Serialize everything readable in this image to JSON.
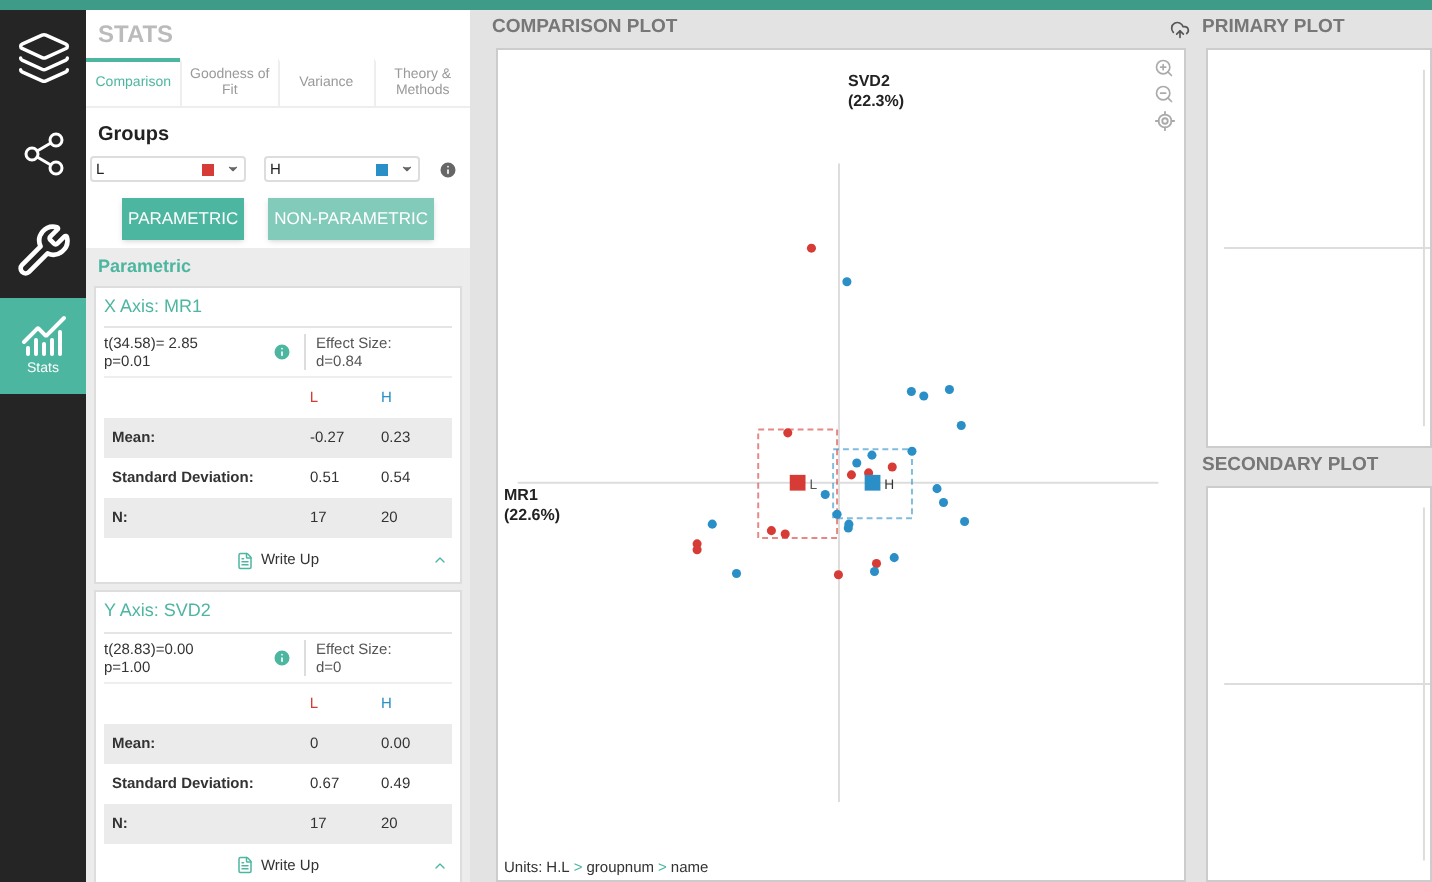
{
  "sidebar": {
    "items": [
      {
        "kind": "window",
        "selected": false
      },
      {
        "kind": "network",
        "selected": false
      },
      {
        "kind": "tools",
        "selected": false
      },
      {
        "kind": "stats",
        "label": "Stats",
        "selected": true
      }
    ]
  },
  "stats": {
    "title": "STATS",
    "tabs": [
      {
        "label": "Comparison",
        "selected": true
      },
      {
        "label": "Goodness of Fit",
        "selected": false
      },
      {
        "label": "Variance",
        "selected": false
      },
      {
        "label": "Theory & Methods",
        "selected": false
      }
    ],
    "groups_label": "Groups",
    "group_selects": [
      {
        "value": "L",
        "color": "#d63b35"
      },
      {
        "value": "H",
        "color": "#2a8fc7"
      }
    ],
    "buttons": [
      {
        "label": "PARAMETRIC",
        "selected": true
      },
      {
        "label": "NON-PARAMETRIC",
        "selected": false
      }
    ],
    "section_title": "Parametric",
    "cards": [
      {
        "title": "X Axis: MR1",
        "test": [
          "t(34.58)= 2.85",
          "p=0.01"
        ],
        "effect_label": "Effect Size:",
        "effect_value": "d=0.84",
        "columns": [
          "L",
          "H"
        ],
        "rows": [
          {
            "label": "Mean:",
            "values": [
              "-0.27",
              "0.23"
            ]
          },
          {
            "label": "Standard Deviation:",
            "values": [
              "0.51",
              "0.54"
            ]
          },
          {
            "label": "N:",
            "values": [
              "17",
              "20"
            ]
          }
        ],
        "write_up": "Write Up"
      },
      {
        "title": "Y Axis: SVD2",
        "test": [
          "t(28.83)=0.00",
          "p=1.00"
        ],
        "effect_label": "Effect Size:",
        "effect_value": "d=0",
        "columns": [
          "L",
          "H"
        ],
        "rows": [
          {
            "label": "Mean:",
            "values": [
              "0",
              "0.00"
            ]
          },
          {
            "label": "Standard Deviation:",
            "values": [
              "0.67",
              "0.49"
            ]
          },
          {
            "label": "N:",
            "values": [
              "17",
              "20"
            ]
          }
        ],
        "write_up": "Write Up"
      }
    ]
  },
  "comparison_plot": {
    "title": "COMPARISON PLOT",
    "y_axis": [
      "SVD2",
      "(22.3%)"
    ],
    "x_axis": [
      "MR1",
      "(22.6%)"
    ],
    "mean_labels": [
      "L",
      "H"
    ],
    "units": {
      "label": "Units:",
      "path": [
        "H.L",
        "groupnum",
        "name"
      ],
      "separator": ">"
    }
  },
  "primary_plot": {
    "title": "PRIMARY PLOT"
  },
  "secondary_plot": {
    "title": "SECONDARY PLOT"
  }
}
